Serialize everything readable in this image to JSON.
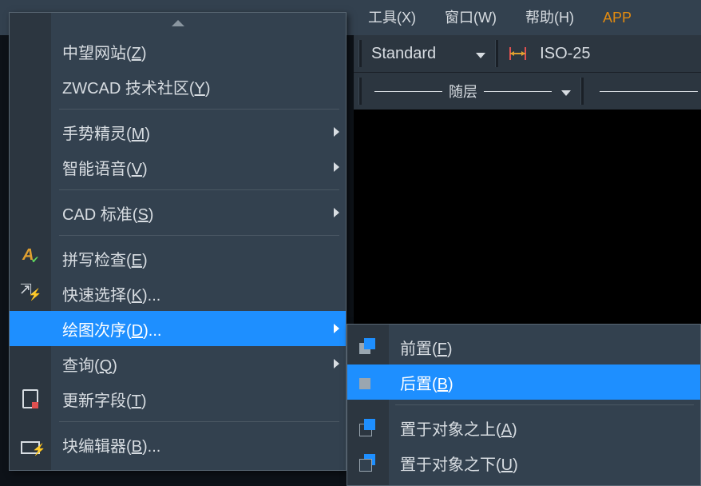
{
  "menubar": {
    "item_tools": "工具(X)",
    "item_tools_prefix": "&#x2800;",
    "item_window": "窗口(W)",
    "item_help": "帮助(H)",
    "item_app": "APP"
  },
  "toolbar": {
    "style_value": "Standard",
    "dim_value": "ISO-25",
    "layer_line_label": "随层"
  },
  "menu": {
    "zwsite": {
      "pre": "中望网站(",
      "ul": "Z",
      "post": ")"
    },
    "zwcomm": {
      "pre": "ZWCAD 技术社区(",
      "ul": "Y",
      "post": ")"
    },
    "gesture": {
      "pre": "手势精灵(",
      "ul": "M",
      "post": ")"
    },
    "voice": {
      "pre": "智能语音(",
      "ul": "V",
      "post": ")"
    },
    "cadstd": {
      "pre": "CAD 标准(",
      "ul": "S",
      "post": ")"
    },
    "spell": {
      "pre": "拼写检查(",
      "ul": "E",
      "post": ")"
    },
    "qsel": {
      "pre": "快速选择(",
      "ul": "K",
      "post": ")..."
    },
    "draworder": {
      "pre": "绘图次序(",
      "ul": "D",
      "post": ")..."
    },
    "query": {
      "pre": "查询(",
      "ul": "Q",
      "post": ")"
    },
    "updatef": {
      "pre": "更新字段(",
      "ul": "T",
      "post": ")"
    },
    "bedit": {
      "pre": "块编辑器(",
      "ul": "B",
      "post": ")..."
    }
  },
  "submenu": {
    "front": {
      "pre": "前置(",
      "ul": "F",
      "post": ")"
    },
    "back": {
      "pre": "后置(",
      "ul": "B",
      "post": ")"
    },
    "above": {
      "pre": "置于对象之上(",
      "ul": "A",
      "post": ")"
    },
    "below": {
      "pre": "置于对象之下(",
      "ul": "U",
      "post": ")"
    }
  }
}
